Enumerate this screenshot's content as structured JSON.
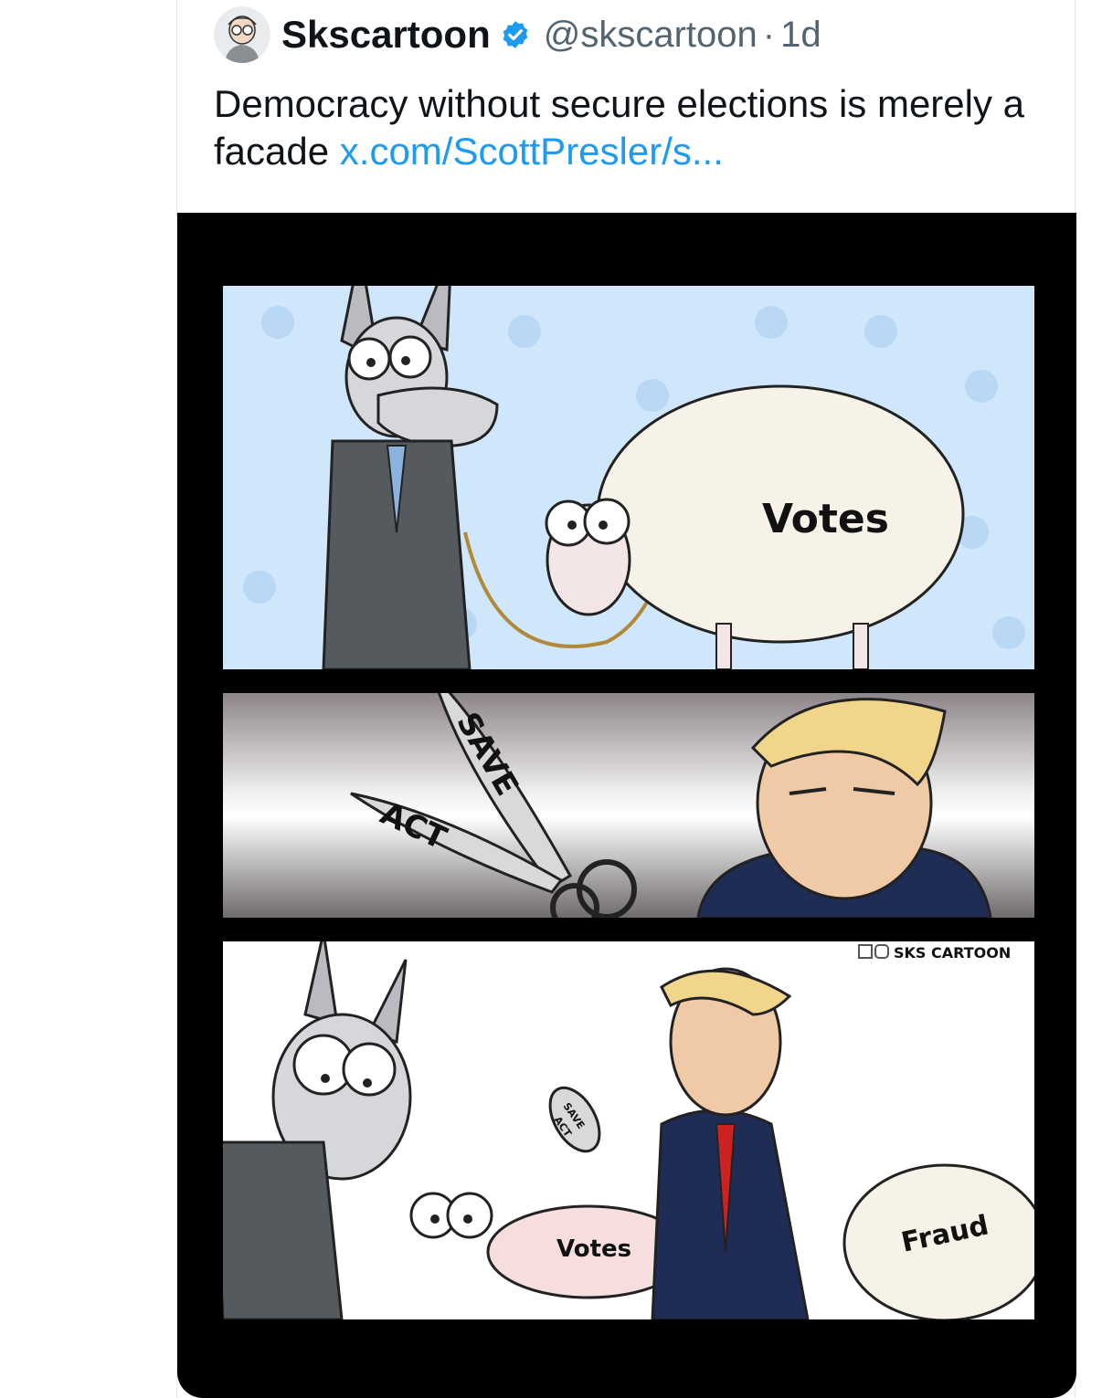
{
  "tweet": {
    "author_name": "Skscartoon",
    "handle": "@skscartoon",
    "separator": "·",
    "time": "1d",
    "text": "Democracy without secure elections is merely a facade",
    "link": "x.com/ScottPresler/s..."
  },
  "cartoon": {
    "panel1_sheep_label": "Votes",
    "panel2_blade_top": "SAVE",
    "panel2_blade_bottom": "ACT",
    "watermark": "SKS CARTOON",
    "panel3_scissors_top": "SAVE",
    "panel3_scissors_bottom": "ACT",
    "panel3_sheep_label": "Votes",
    "panel3_wool_label": "Fraud"
  },
  "colors": {
    "link": "#1d9bf0",
    "verified": "#1d9bf0",
    "panel1_bg": "#cfe6fb",
    "media_bg": "#000000"
  },
  "icons": [
    "verified-badge-icon",
    "x-logo-icon",
    "instagram-icon"
  ]
}
